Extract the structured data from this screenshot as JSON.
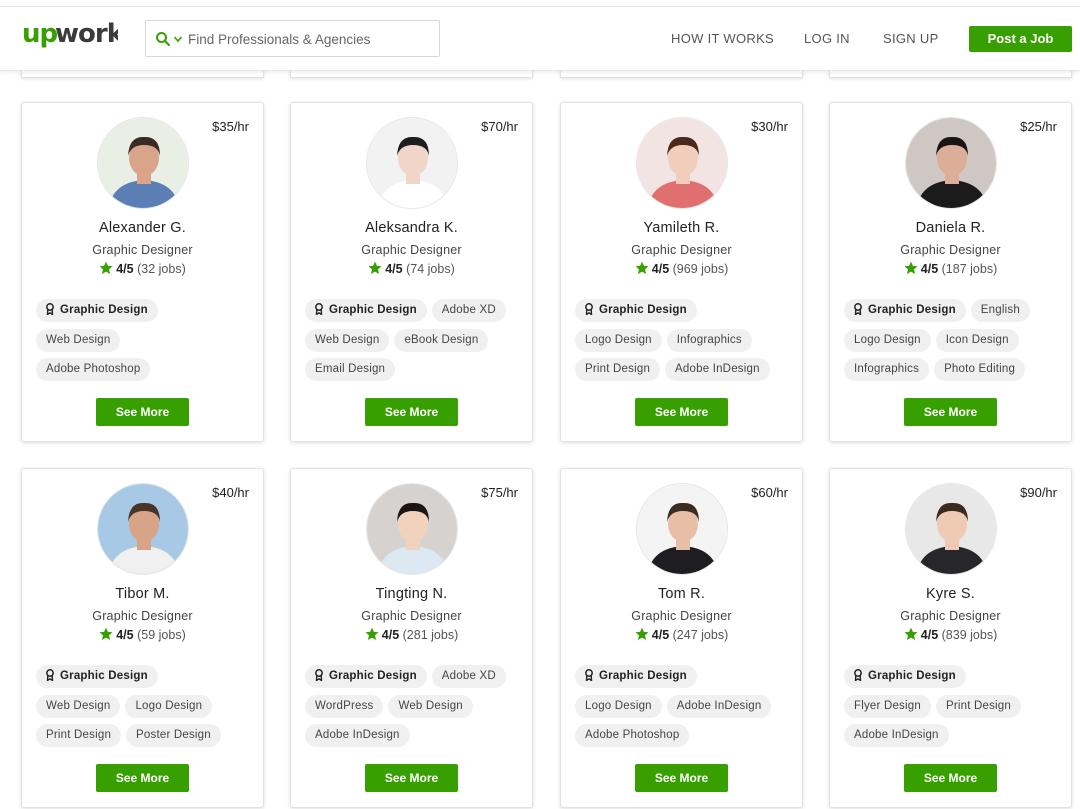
{
  "header": {
    "logo_text": "upwork",
    "search_placeholder": "Find Professionals & Agencies",
    "nav": [
      "HOW IT WORKS",
      "LOG IN",
      "SIGN UP"
    ],
    "post_job_label": "Post a Job"
  },
  "colors": {
    "brand_green": "#37a000"
  },
  "cards": [
    {
      "rate": "$35/hr",
      "name": "Alexander G.",
      "title": "Graphic Designer",
      "score": "4/5",
      "jobs": "(32 jobs)",
      "tags": [
        [
          "Graphic Design"
        ],
        [
          "Web Design"
        ],
        [
          "Adobe Photoshop"
        ]
      ],
      "button": "See More"
    },
    {
      "rate": "$70/hr",
      "name": "Aleksandra K.",
      "title": "Graphic Designer",
      "score": "4/5",
      "jobs": "(74 jobs)",
      "tags": [
        [
          "Graphic Design",
          "Adobe XD"
        ],
        [
          "Web Design",
          "eBook Design"
        ],
        [
          "Email Design"
        ]
      ],
      "button": "See More"
    },
    {
      "rate": "$30/hr",
      "name": "Yamileth R.",
      "title": "Graphic Designer",
      "score": "4/5",
      "jobs": "(969 jobs)",
      "tags": [
        [
          "Graphic Design"
        ],
        [
          "Logo Design",
          "Infographics"
        ],
        [
          "Print Design",
          "Adobe InDesign"
        ]
      ],
      "button": "See More"
    },
    {
      "rate": "$25/hr",
      "name": "Daniela R.",
      "title": "Graphic Designer",
      "score": "4/5",
      "jobs": "(187 jobs)",
      "tags": [
        [
          "Graphic Design",
          "English"
        ],
        [
          "Logo Design",
          "Icon Design"
        ],
        [
          "Infographics",
          "Photo Editing"
        ]
      ],
      "button": "See More"
    },
    {
      "rate": "$40/hr",
      "name": "Tibor M.",
      "title": "Graphic Designer",
      "score": "4/5",
      "jobs": "(59 jobs)",
      "tags": [
        [
          "Graphic Design"
        ],
        [
          "Web Design",
          "Logo Design"
        ],
        [
          "Print Design",
          "Poster Design"
        ]
      ],
      "button": "See More"
    },
    {
      "rate": "$75/hr",
      "name": "Tingting N.",
      "title": "Graphic Designer",
      "score": "4/5",
      "jobs": "(281 jobs)",
      "tags": [
        [
          "Graphic Design",
          "Adobe XD"
        ],
        [
          "WordPress",
          "Web Design"
        ],
        [
          "Adobe InDesign"
        ]
      ],
      "button": "See More"
    },
    {
      "rate": "$60/hr",
      "name": "Tom R.",
      "title": "Graphic Designer",
      "score": "4/5",
      "jobs": "(247 jobs)",
      "tags": [
        [
          "Graphic Design"
        ],
        [
          "Logo Design",
          "Adobe InDesign"
        ],
        [
          "Adobe Photoshop"
        ]
      ],
      "button": "See More"
    },
    {
      "rate": "$90/hr",
      "name": "Kyre S.",
      "title": "Graphic Designer",
      "score": "4/5",
      "jobs": "(839 jobs)",
      "tags": [
        [
          "Graphic Design"
        ],
        [
          "Flyer Design",
          "Print Design"
        ],
        [
          "Adobe InDesign"
        ]
      ],
      "button": "See More"
    }
  ]
}
